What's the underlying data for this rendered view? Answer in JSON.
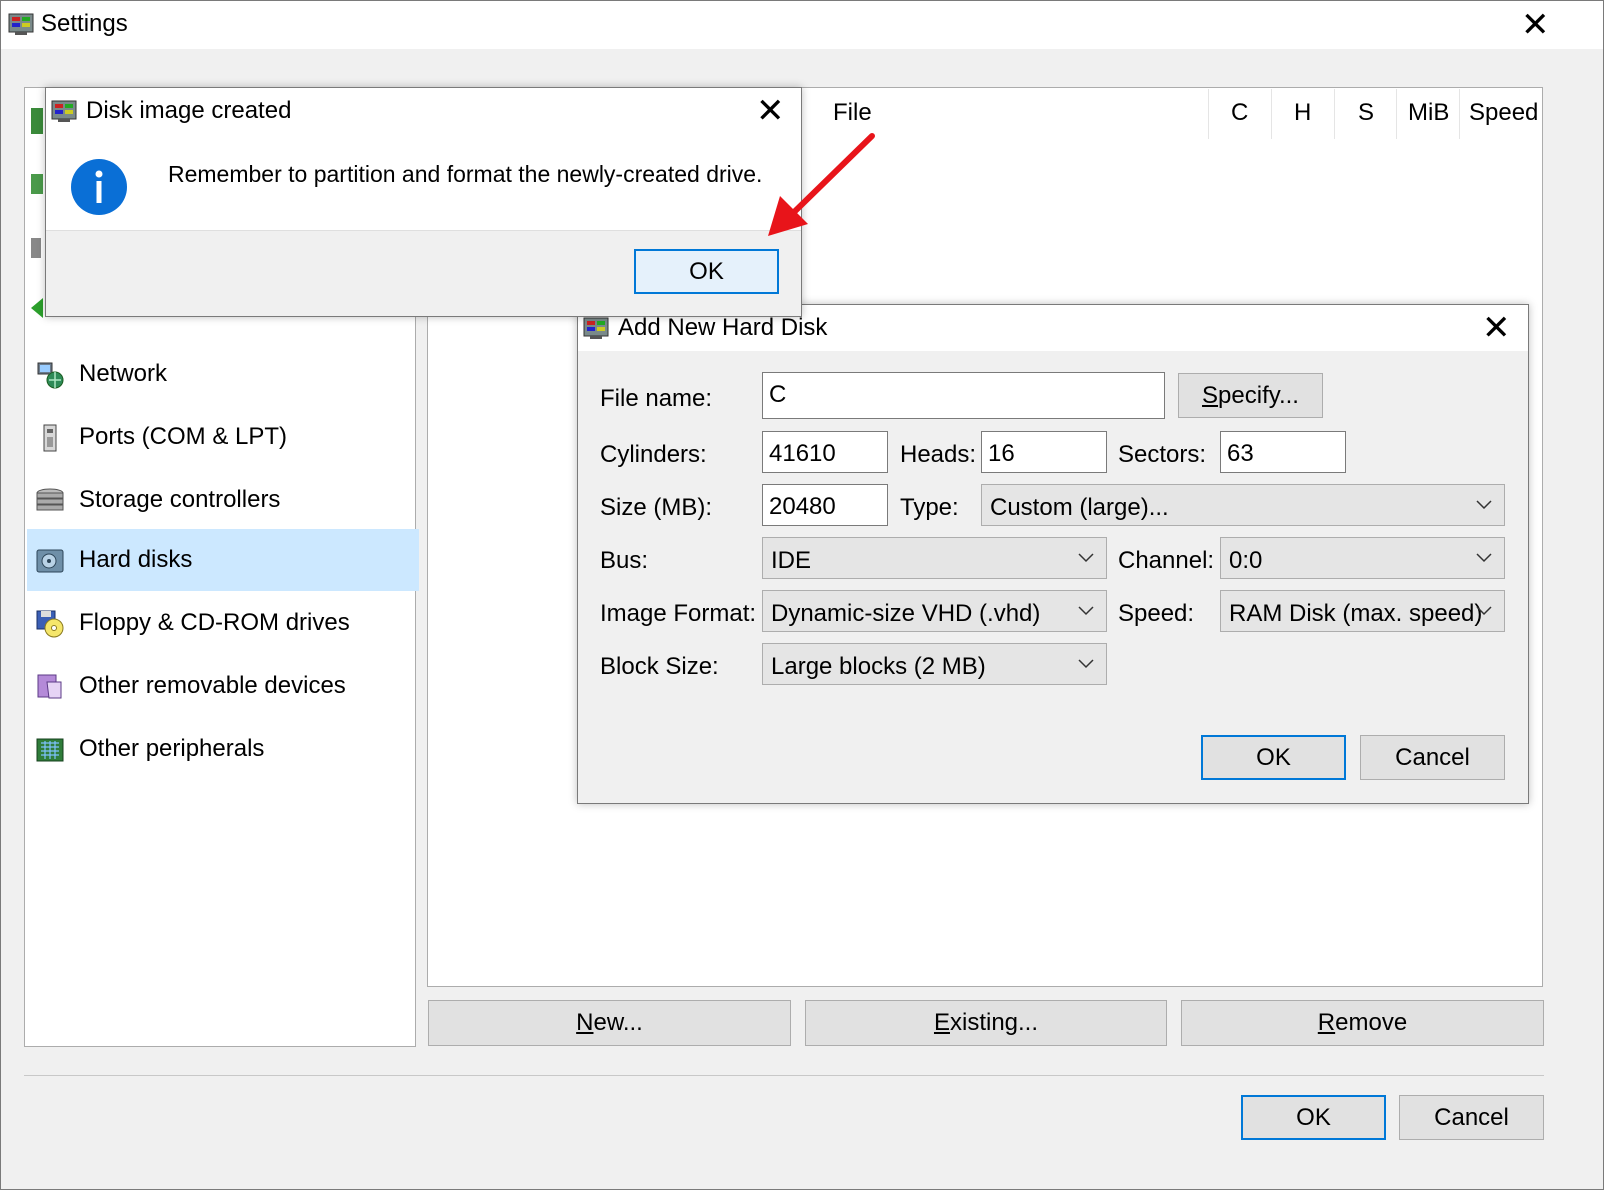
{
  "window": {
    "title": "Settings"
  },
  "nav": {
    "items": [
      {
        "label": "Network",
        "icon": "network-icon"
      },
      {
        "label": "Ports (COM & LPT)",
        "icon": "ports-icon"
      },
      {
        "label": "Storage controllers",
        "icon": "storage-controllers-icon"
      },
      {
        "label": "Hard disks",
        "icon": "hard-disk-icon",
        "selected": true
      },
      {
        "label": "Floppy & CD-ROM drives",
        "icon": "floppy-cdrom-icon"
      },
      {
        "label": "Other removable devices",
        "icon": "removable-devices-icon"
      },
      {
        "label": "Other peripherals",
        "icon": "peripherals-icon"
      }
    ]
  },
  "disk_table": {
    "columns": [
      "File",
      "C",
      "H",
      "S",
      "MiB",
      "Speed"
    ]
  },
  "disk_buttons": {
    "new": {
      "prefix": "",
      "mnemonic": "N",
      "rest": "ew..."
    },
    "existing": {
      "prefix": "",
      "mnemonic": "E",
      "rest": "xisting..."
    },
    "remove": {
      "prefix": "",
      "mnemonic": "R",
      "rest": "emove"
    }
  },
  "footer": {
    "ok": "OK",
    "cancel": "Cancel"
  },
  "message_box": {
    "title": "Disk image created",
    "message": "Remember to partition and format the newly-created drive.",
    "ok": "OK",
    "icon": "info-icon"
  },
  "add_disk": {
    "title": "Add New Hard Disk",
    "file_name_label": "File name:",
    "file_name_value": "C",
    "specify": {
      "prefix": "",
      "mnemonic": "S",
      "rest": "pecify..."
    },
    "cylinders_label": "Cylinders:",
    "cylinders_value": "41610",
    "heads_label": "Heads:",
    "heads_value": "16",
    "sectors_label": "Sectors:",
    "sectors_value": "63",
    "size_label": "Size (MB):",
    "size_value": "20480",
    "type_label": "Type:",
    "type_value": "Custom (large)...",
    "bus_label": "Bus:",
    "bus_value": "IDE",
    "channel_label": "Channel:",
    "channel_value": "0:0",
    "image_format_label": "Image Format:",
    "image_format_value": "Dynamic-size VHD (.vhd)",
    "speed_label": "Speed:",
    "speed_value": "RAM Disk (max. speed)",
    "block_size_label": "Block Size:",
    "block_size_value": "Large blocks (2 MB)",
    "ok": "OK",
    "cancel": "Cancel"
  },
  "colors": {
    "selection": "#cce8ff",
    "accent": "#0078d7",
    "info_blue": "#0a6fd6",
    "arrow_red": "#e8141a"
  }
}
